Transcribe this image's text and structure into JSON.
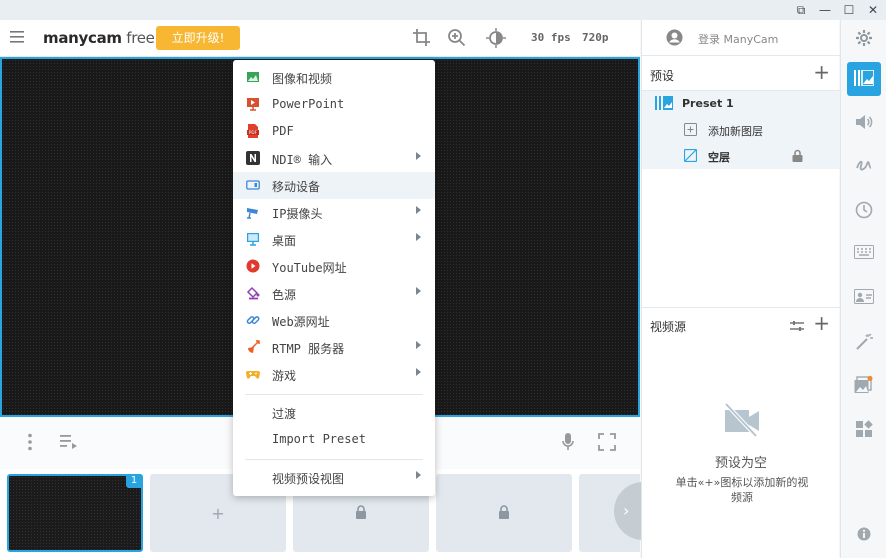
{
  "window": {
    "restore_glyph": "⧉",
    "minimize_glyph": "—",
    "maximize_glyph": "☐",
    "close_glyph": "✕"
  },
  "toolbar": {
    "logo_brand": "manycam",
    "logo_edition": "free",
    "upgrade_label": "立即升级!",
    "fps": "30 fps",
    "resolution": "720p"
  },
  "menu": {
    "items": [
      {
        "label": "图像和视频",
        "icon": "image-icon",
        "has_submenu": false
      },
      {
        "label": "PowerPoint",
        "icon": "powerpoint-icon",
        "has_submenu": false
      },
      {
        "label": "PDF",
        "icon": "pdf-icon",
        "has_submenu": false
      },
      {
        "label": "NDI® 输入",
        "icon": "ndi-icon",
        "has_submenu": true
      },
      {
        "label": "移动设备",
        "icon": "mobile-device-icon",
        "has_submenu": false
      },
      {
        "label": "IP摄像头",
        "icon": "ip-camera-icon",
        "has_submenu": true
      },
      {
        "label": "桌面",
        "icon": "desktop-icon",
        "has_submenu": true
      },
      {
        "label": "YouTube网址",
        "icon": "youtube-icon",
        "has_submenu": false
      },
      {
        "label": "色源",
        "icon": "color-source-icon",
        "has_submenu": true
      },
      {
        "label": "Web源网址",
        "icon": "link-icon",
        "has_submenu": false
      },
      {
        "label": "RTMP 服务器",
        "icon": "rtmp-icon",
        "has_submenu": true
      },
      {
        "label": "游戏",
        "icon": "gamepad-icon",
        "has_submenu": true
      }
    ],
    "transition_label": "过渡",
    "import_preset_label": "Import Preset",
    "preset_view_label": "视频预设视图"
  },
  "right_panel": {
    "login_label": "登录 ManyCam",
    "presets_title": "预设",
    "preset_name": "Preset 1",
    "add_layer_label": "添加新图层",
    "empty_layer_label": "空层",
    "video_sources_title": "视频源",
    "empty_title": "预设为空",
    "empty_desc": "单击«+»图标以添加新的视频源"
  },
  "thumbnails": {
    "active_badge": "1"
  },
  "colors": {
    "accent": "#2aa4e0",
    "upgrade": "#f7b733"
  }
}
